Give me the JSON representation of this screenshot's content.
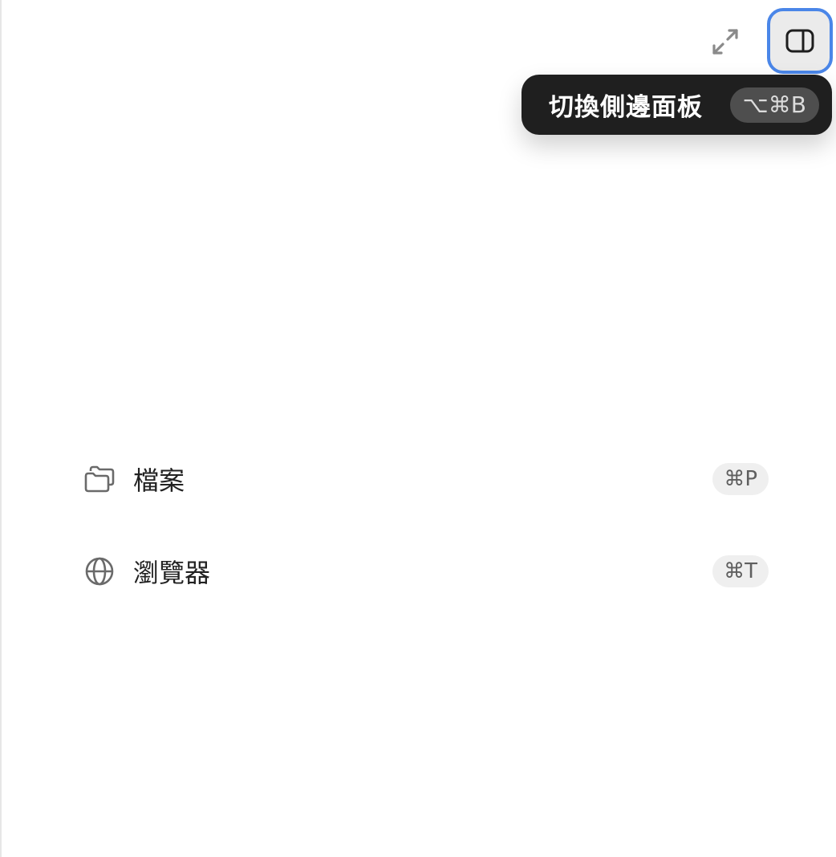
{
  "toolbar": {
    "expand_icon": "expand-arrows-icon",
    "sidebar_icon": "sidebar-panel-icon",
    "focus_ring_color": "#4a86e8"
  },
  "tooltip": {
    "label": "切換側邊面板",
    "shortcut": "⌥⌘B"
  },
  "menu": {
    "items": [
      {
        "label": "檔案",
        "shortcut": "⌘P",
        "icon": "folders-icon"
      },
      {
        "label": "瀏覽器",
        "shortcut": "⌘T",
        "icon": "globe-icon"
      }
    ]
  }
}
